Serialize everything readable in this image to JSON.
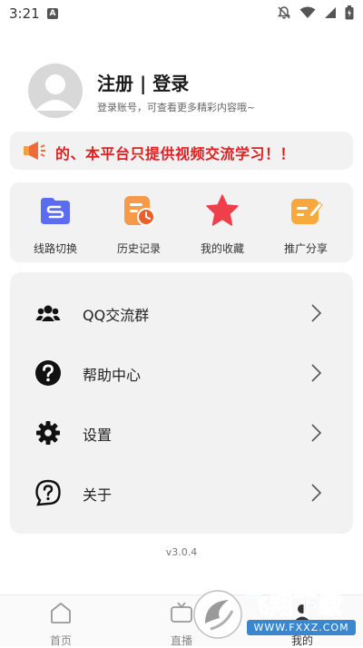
{
  "status_bar": {
    "time": "3:21",
    "notification_badge": "A"
  },
  "profile": {
    "title": "注册 | 登录",
    "subtitle": "登录账号，可查看更多精彩内容哦~"
  },
  "notice": {
    "text": "的、本平台只提供视频交流学习！！",
    "color": "#e02020"
  },
  "quick_actions": [
    {
      "label": "线路切换",
      "icon": "route-switch-icon"
    },
    {
      "label": "历史记录",
      "icon": "history-icon"
    },
    {
      "label": "我的收藏",
      "icon": "favorites-star-icon"
    },
    {
      "label": "推广分享",
      "icon": "share-icon"
    }
  ],
  "menu": [
    {
      "label": "QQ交流群",
      "icon": "group-icon"
    },
    {
      "label": "帮助中心",
      "icon": "help-icon"
    },
    {
      "label": "设置",
      "icon": "gear-icon"
    },
    {
      "label": "关于",
      "icon": "about-icon"
    }
  ],
  "version": "v3.0.4",
  "bottom_nav": [
    {
      "label": "首页",
      "icon": "home-icon"
    },
    {
      "label": "直播",
      "icon": "tv-icon"
    },
    {
      "label": "我的",
      "icon": "profile-icon"
    }
  ],
  "watermark": {
    "text": "飞翔下载",
    "url": "WWW.FXXZ.COM"
  }
}
